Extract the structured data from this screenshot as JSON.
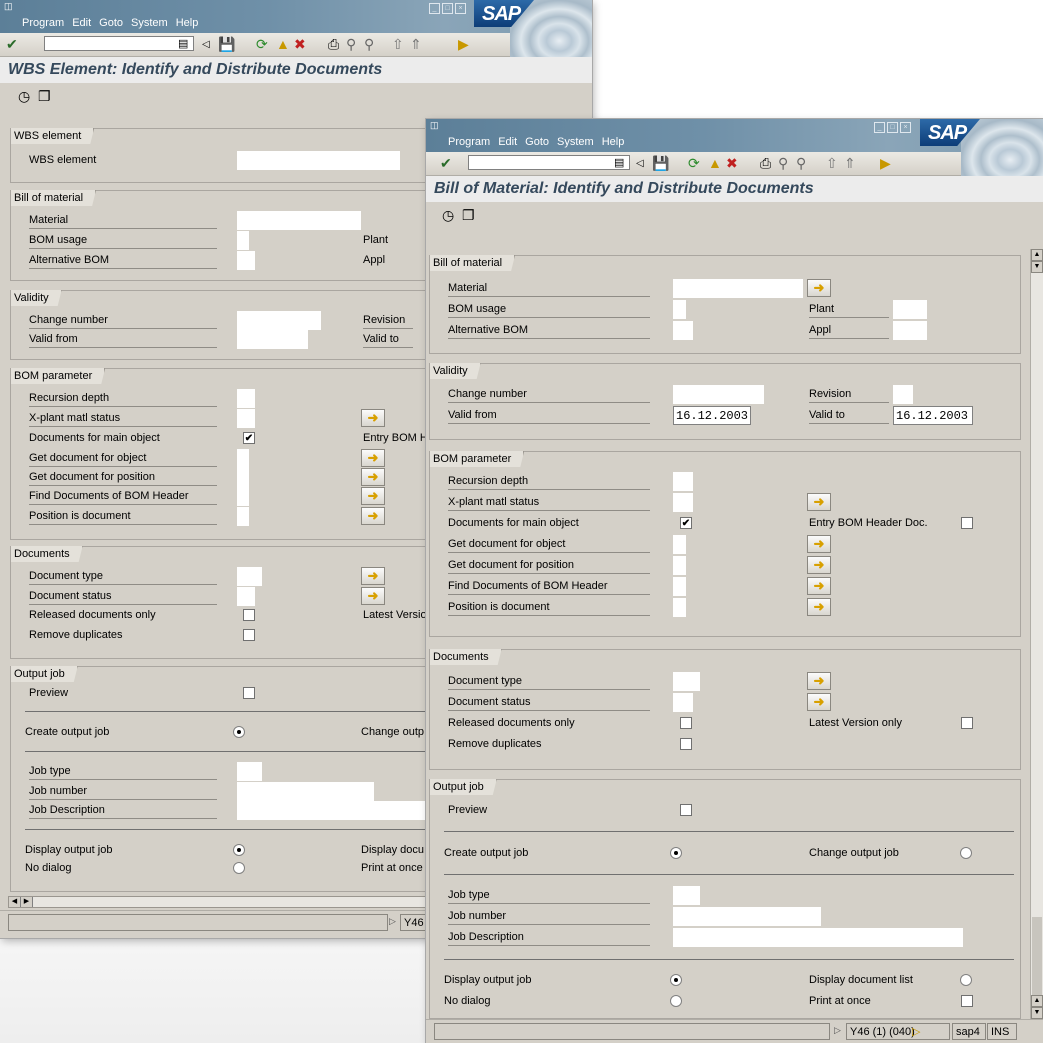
{
  "windows": {
    "back": {
      "menu": [
        "Program",
        "Edit",
        "Goto",
        "System",
        "Help"
      ],
      "title": "WBS Element: Identify and Distribute Documents",
      "logo": "SAP",
      "groups": {
        "wbs": {
          "title": "WBS element",
          "wbs_element": "WBS element"
        },
        "bom": {
          "title": "Bill of material",
          "material": "Material",
          "bom_usage": "BOM usage",
          "alternative_bom": "Alternative BOM",
          "plant": "Plant",
          "appl": "Appl"
        },
        "validity": {
          "title": "Validity",
          "change_number": "Change number",
          "valid_from": "Valid from",
          "revision": "Revision",
          "valid_to": "Valid to"
        },
        "bomparam": {
          "title": "BOM parameter",
          "recursion_depth": "Recursion depth",
          "xplant": "X-plant matl status",
          "docs_main": "Documents for main object",
          "entry_bom": "Entry BOM H",
          "get_doc_obj": "Get document for object",
          "get_doc_pos": "Get document for position",
          "find_docs": "Find Documents of BOM Header",
          "pos_is_doc": "Position is document"
        },
        "documents": {
          "title": "Documents",
          "doc_type": "Document type",
          "doc_status": "Document status",
          "released": "Released documents only",
          "latest": "Latest Versio",
          "remove_dup": "Remove duplicates"
        },
        "output": {
          "title": "Output job",
          "preview": "Preview",
          "create": "Create output job",
          "change": "Change outp",
          "job_type": "Job type",
          "job_number": "Job number",
          "job_desc": "Job Description",
          "display_output": "Display output job",
          "display_doc": "Display docu",
          "no_dialog": "No dialog",
          "print_once": "Print at once"
        }
      },
      "status_text": "Y46"
    },
    "front": {
      "menu": [
        "Program",
        "Edit",
        "Goto",
        "System",
        "Help"
      ],
      "title": "Bill of Material: Identify and Distribute Documents",
      "logo": "SAP",
      "groups": {
        "bom": {
          "title": "Bill of material",
          "material": "Material",
          "bom_usage": "BOM usage",
          "alternative_bom": "Alternative BOM",
          "plant": "Plant",
          "appl": "Appl"
        },
        "validity": {
          "title": "Validity",
          "change_number": "Change number",
          "valid_from": "Valid from",
          "valid_from_value": "16.12.2003",
          "revision": "Revision",
          "valid_to": "Valid to",
          "valid_to_value": "16.12.2003"
        },
        "bomparam": {
          "title": "BOM parameter",
          "recursion_depth": "Recursion depth",
          "xplant": "X-plant matl status",
          "docs_main": "Documents for main object",
          "entry_bom": "Entry BOM Header Doc.",
          "get_doc_obj": "Get document for object",
          "get_doc_pos": "Get document for position",
          "find_docs": "Find Documents of BOM Header",
          "pos_is_doc": "Position is document"
        },
        "documents": {
          "title": "Documents",
          "doc_type": "Document type",
          "doc_status": "Document status",
          "released": "Released documents only",
          "latest": "Latest Version only",
          "remove_dup": "Remove duplicates"
        },
        "output": {
          "title": "Output job",
          "preview": "Preview",
          "create": "Create output job",
          "change": "Change output job",
          "job_type": "Job type",
          "job_number": "Job number",
          "job_desc": "Job Description",
          "display_output": "Display output job",
          "display_doc": "Display document list",
          "no_dialog": "No dialog",
          "print_once": "Print at once"
        }
      },
      "status": {
        "session": "Y46 (1) (040)",
        "server": "sap4",
        "mode": "INS"
      }
    }
  },
  "checkmark": "✔",
  "icons": {
    "enter": "check-circle-icon",
    "save": "save-icon",
    "back": "back-icon",
    "exit": "exit-icon",
    "cancel": "cancel-icon",
    "print": "print-icon",
    "find": "find-icon",
    "execute": "execute-icon",
    "arrow": "multiple-selection-arrow-icon"
  }
}
